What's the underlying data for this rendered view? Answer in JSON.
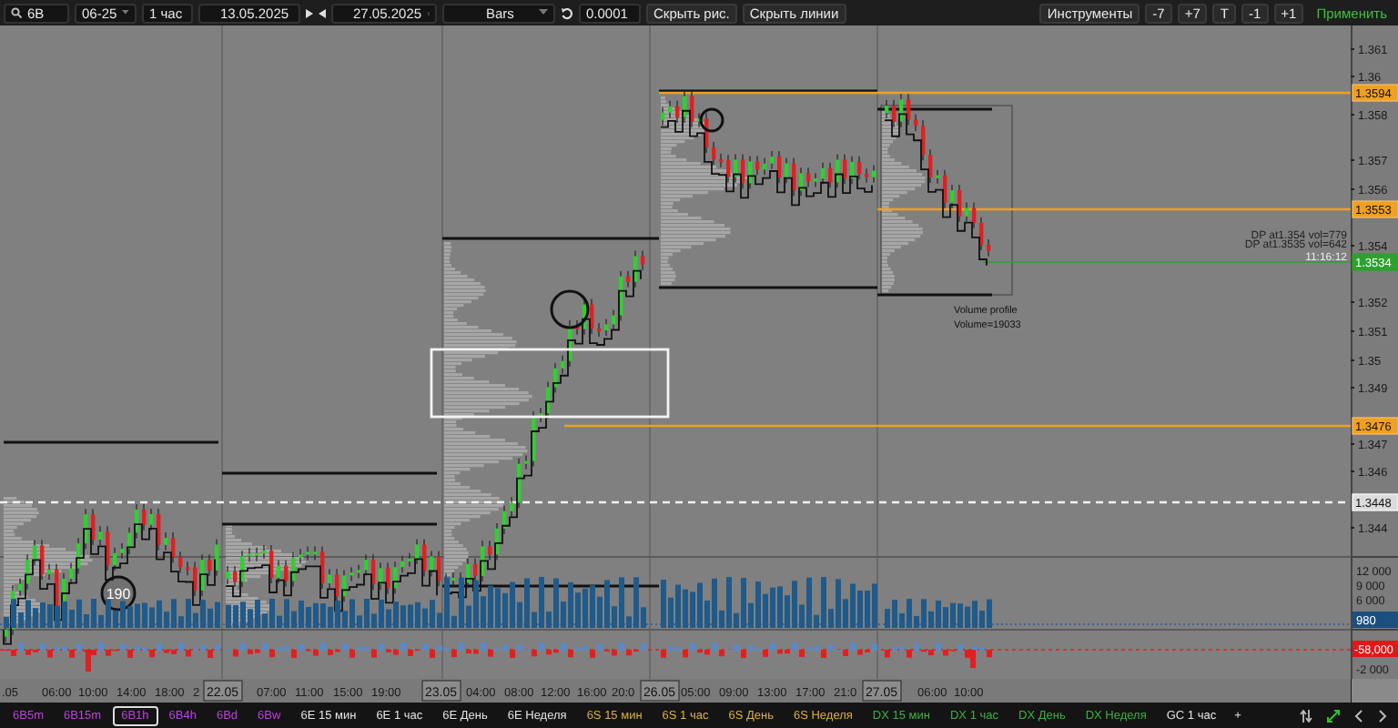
{
  "toolbar": {
    "symbol": "6B",
    "contract": "06-25",
    "timeframe": "1 час",
    "date_from": "13.05.2025",
    "date_to": "27.05.2025",
    "chart_type": "Bars",
    "tick_size": "0.0001",
    "buttons": [
      "Скрыть рис.",
      "Скрыть линии"
    ],
    "tools_label": "Инструменты",
    "steps": [
      "-7",
      "+7",
      "T",
      "-1",
      "+1"
    ],
    "apply": "Применить"
  },
  "chart": {
    "cluster_label": "190",
    "dp_labels": [
      "DP at1.354 vol=779",
      "DP at1.3535 vol=642"
    ],
    "last_time": "11:16:12",
    "profile_title": "Volume profile",
    "profile_volume": "Volume=19033"
  },
  "price_axis": {
    "ticks": [
      "1.361",
      "1.36",
      "1.358",
      "1.357",
      "1.356",
      "1.354",
      "1.352",
      "1.351",
      "1.35",
      "1.349",
      "1.347",
      "1.346",
      "1.344"
    ],
    "markers": [
      {
        "text": "1.3594",
        "kind": "level"
      },
      {
        "text": "1.3553",
        "kind": "level"
      },
      {
        "text": "1.3534",
        "kind": "last"
      },
      {
        "text": "1.3476",
        "kind": "level"
      },
      {
        "text": "1.3448",
        "kind": "dashed"
      }
    ]
  },
  "volume_axis": {
    "ticks": [
      "12 000",
      "9 000",
      "6 000"
    ],
    "current": "980"
  },
  "delta_axis": {
    "current": "-58,000",
    "ticks": [
      "-2 000"
    ]
  },
  "time_axis": [
    {
      "text": ".05",
      "kind": "time"
    },
    {
      "text": "06:00",
      "kind": "time"
    },
    {
      "text": "10:00",
      "kind": "time"
    },
    {
      "text": "14:00",
      "kind": "time"
    },
    {
      "text": "18:00",
      "kind": "time"
    },
    {
      "text": "2",
      "kind": "time"
    },
    {
      "text": "22.05",
      "kind": "date"
    },
    {
      "text": "07:00",
      "kind": "time"
    },
    {
      "text": "11:00",
      "kind": "time"
    },
    {
      "text": "15:00",
      "kind": "time"
    },
    {
      "text": "19:00",
      "kind": "time"
    },
    {
      "text": "23.05",
      "kind": "date"
    },
    {
      "text": "04:00",
      "kind": "time"
    },
    {
      "text": "08:00",
      "kind": "time"
    },
    {
      "text": "12:00",
      "kind": "time"
    },
    {
      "text": "16:00",
      "kind": "time"
    },
    {
      "text": "20:0",
      "kind": "time"
    },
    {
      "text": "26.05",
      "kind": "date"
    },
    {
      "text": "05:00",
      "kind": "time"
    },
    {
      "text": "09:00",
      "kind": "time"
    },
    {
      "text": "13:00",
      "kind": "time"
    },
    {
      "text": "17:00",
      "kind": "time"
    },
    {
      "text": "21:0",
      "kind": "time"
    },
    {
      "text": "27.05",
      "kind": "date"
    },
    {
      "text": "06:00",
      "kind": "time"
    },
    {
      "text": "10:00",
      "kind": "time"
    }
  ],
  "tabs": [
    {
      "label": "6B5m",
      "color": "#c040e0",
      "selected": false
    },
    {
      "label": "6B15m",
      "color": "#c040e0",
      "selected": false
    },
    {
      "label": "6B1h",
      "color": "#c040e0",
      "selected": true
    },
    {
      "label": "6B4h",
      "color": "#c040e0",
      "selected": false
    },
    {
      "label": "6Bd",
      "color": "#c040e0",
      "selected": false
    },
    {
      "label": "6Bw",
      "color": "#c040e0",
      "selected": false
    },
    {
      "label": "6E 15 мин",
      "color": "#e6e6e6",
      "selected": false
    },
    {
      "label": "6E 1 час",
      "color": "#e6e6e6",
      "selected": false
    },
    {
      "label": "6E День",
      "color": "#e6e6e6",
      "selected": false
    },
    {
      "label": "6E Неделя",
      "color": "#e6e6e6",
      "selected": false
    },
    {
      "label": "6S 15 мин",
      "color": "#e0b040",
      "selected": false
    },
    {
      "label": "6S 1 час",
      "color": "#e0b040",
      "selected": false
    },
    {
      "label": "6S День",
      "color": "#e0b040",
      "selected": false
    },
    {
      "label": "6S Неделя",
      "color": "#e0b040",
      "selected": false
    },
    {
      "label": "DX 15 мин",
      "color": "#3cb043",
      "selected": false
    },
    {
      "label": "DX 1 час",
      "color": "#3cb043",
      "selected": false
    },
    {
      "label": "DX День",
      "color": "#3cb043",
      "selected": false
    },
    {
      "label": "DX Неделя",
      "color": "#3cb043",
      "selected": false
    },
    {
      "label": "GC 1 час",
      "color": "#e6e6e6",
      "selected": false
    }
  ],
  "add_tab": "+"
}
